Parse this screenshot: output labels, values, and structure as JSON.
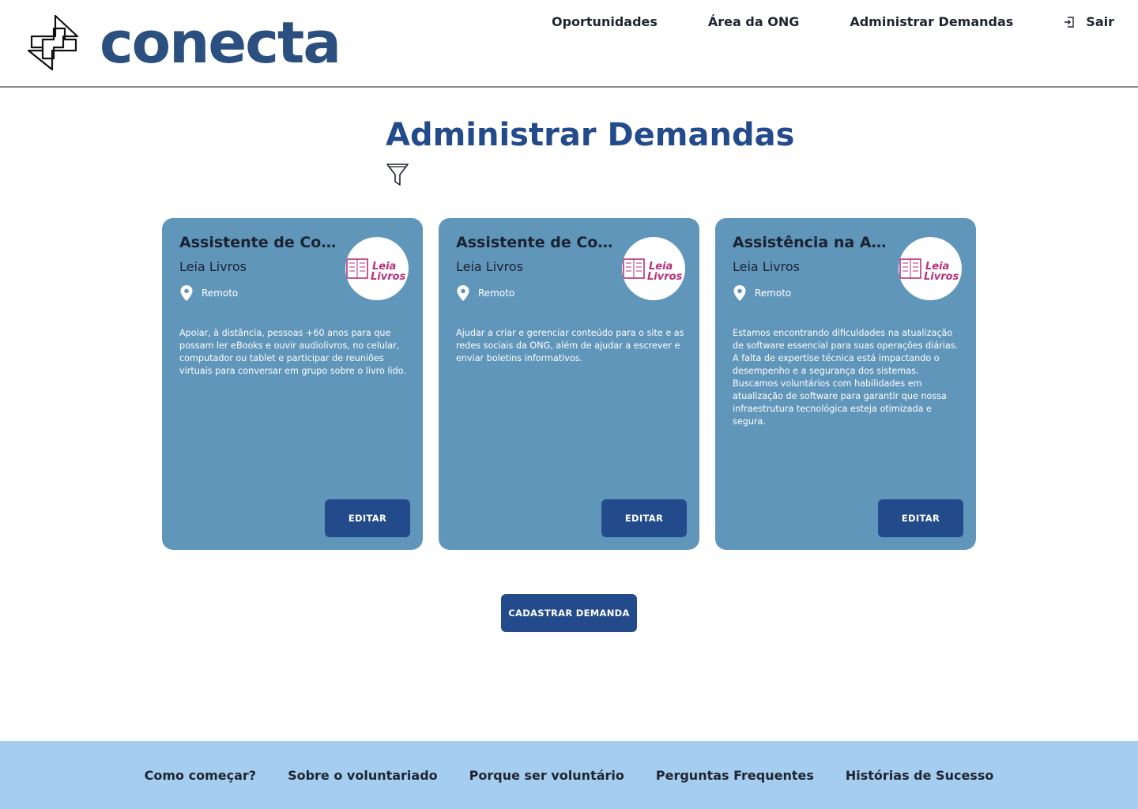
{
  "brand": {
    "name": "conecta",
    "color": "#2b4f7e"
  },
  "nav": {
    "items": [
      "Oportunidades",
      "Área da ONG",
      "Administrar Demandas"
    ],
    "logout_label": "Sair"
  },
  "page": {
    "title": "Administrar Demandas"
  },
  "cards": [
    {
      "title": "Assistente de Co...",
      "org": "Leia Livros",
      "location": "Remoto",
      "description": "Apoiar, à distância, pessoas +60 anos para que possam ler eBooks e ouvir audiolivros, no celular, computador ou tablet e participar de reuniões virtuais para conversar em grupo sobre o livro lido.",
      "button": "EDITAR"
    },
    {
      "title": "Assistente de Co...",
      "org": "Leia Livros",
      "location": "Remoto",
      "description": "Ajudar a criar e gerenciar conteúdo para o site e as redes sociais da ONG, além de ajudar a escrever e enviar boletins informativos.",
      "button": "EDITAR"
    },
    {
      "title": "Assistência na At...",
      "org": "Leia Livros",
      "location": "Remoto",
      "description": "Estamos encontrando dificuldades na atualização de software essencial para suas operações diárias. A falta de expertise técnica está impactando o desempenho e a segurança dos sistemas. Buscamos voluntários com habilidades em atualização de software para garantir que nossa infraestrutura tecnológica esteja otimizada e segura.",
      "button": "EDITAR"
    }
  ],
  "org_logo": {
    "line1": "Leia",
    "line2": "Livros",
    "color": "#b8327a"
  },
  "register_button": "CADASTRAR DEMANDA",
  "footer": {
    "links": [
      "Como começar?",
      "Sobre o voluntariado",
      "Porque ser voluntário",
      "Perguntas Frequentes",
      "Histórias de Sucesso"
    ]
  },
  "colors": {
    "primary": "#234b8c",
    "card": "#6196bb",
    "footer": "#a4cdf0"
  },
  "icons": {
    "logo": "arrows-exchange-icon",
    "logout": "logout-icon",
    "filter": "filter-icon",
    "location": "location-pin-icon"
  }
}
